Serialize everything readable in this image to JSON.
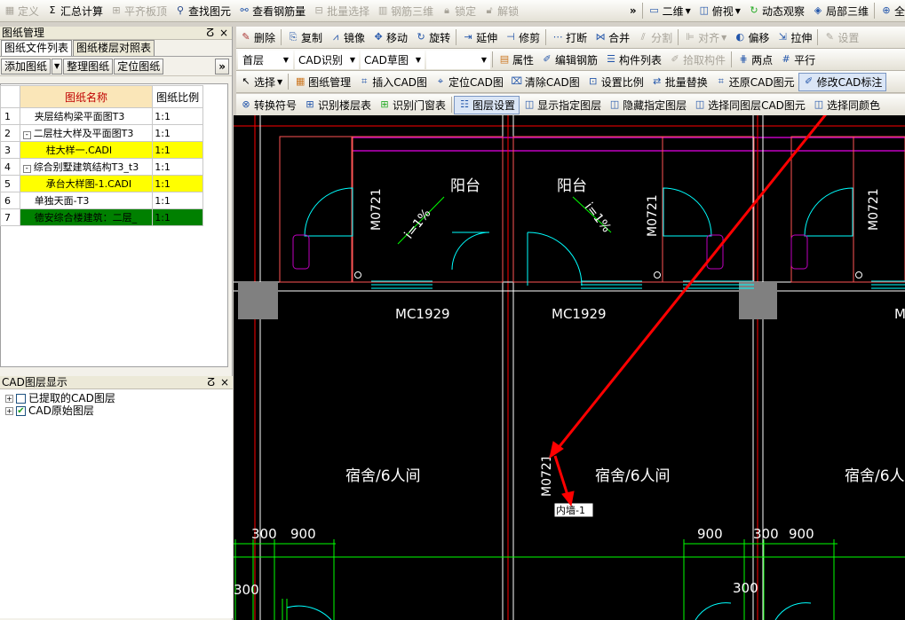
{
  "toolbar1": {
    "items": [
      "定义",
      "汇总计算",
      "平齐板顶",
      "查找图元",
      "查看钢筋量",
      "批量选择",
      "钢筋三维",
      "锁定",
      "解锁"
    ],
    "view_mode": "二维",
    "view_angle": "俯视",
    "dynamic": "动态观察",
    "local3d": "局部三维",
    "more": "»"
  },
  "toolbar2": {
    "items": [
      "删除",
      "复制",
      "镜像",
      "移动",
      "旋转",
      "延伸",
      "修剪",
      "打断",
      "合并",
      "分割",
      "对齐",
      "偏移",
      "拉伸",
      "设置"
    ]
  },
  "toolbar3": {
    "floor": "首层",
    "cad_recog": "CAD识别",
    "cad_draft": "CAD草图",
    "blank": "",
    "items": [
      "属性",
      "编辑钢筋",
      "构件列表",
      "拾取构件",
      "两点",
      "平行"
    ]
  },
  "toolbar4": {
    "select": "选择",
    "items": [
      "图纸管理",
      "插入CAD图",
      "定位CAD图",
      "清除CAD图",
      "设置比例",
      "批量替换",
      "还原CAD图元",
      "修改CAD标注"
    ]
  },
  "toolbar5": {
    "items": [
      "转换符号",
      "识别楼层表",
      "识别门窗表",
      "图层设置",
      "显示指定图层",
      "隐藏指定图层",
      "选择同图层CAD图元",
      "选择同颜色"
    ]
  },
  "drawing_panel": {
    "title": "图纸管理",
    "pin": "ꟷ",
    "close": "×",
    "tabs": [
      "图纸文件列表",
      "图纸楼层对照表"
    ],
    "buttons": [
      "添加图纸",
      "整理图纸",
      "定位图纸"
    ],
    "more": "»",
    "columns": [
      "图纸名称",
      "图纸比例"
    ],
    "rows": [
      {
        "n": "1",
        "name": "夹层结构梁平面图T3",
        "scale": "1:1",
        "style": "",
        "indent": 0,
        "exp": ""
      },
      {
        "n": "2",
        "name": "二层柱大样及平面图T3",
        "scale": "1:1",
        "style": "",
        "indent": 0,
        "exp": "-"
      },
      {
        "n": "3",
        "name": "柱大样一.CADI",
        "scale": "1:1",
        "style": "yellow",
        "indent": 1,
        "exp": ""
      },
      {
        "n": "4",
        "name": "综合别墅建筑结构T3_t3",
        "scale": "1:1",
        "style": "",
        "indent": 0,
        "exp": "-"
      },
      {
        "n": "5",
        "name": "承台大样图-1.CADI",
        "scale": "1:1",
        "style": "yellow",
        "indent": 1,
        "exp": ""
      },
      {
        "n": "6",
        "name": "单独天面-T3",
        "scale": "1:1",
        "style": "",
        "indent": 0,
        "exp": ""
      },
      {
        "n": "7",
        "name": "德安综合楼建筑：二层_",
        "scale": "1:1",
        "style": "green",
        "indent": 0,
        "exp": ""
      }
    ]
  },
  "layer_panel": {
    "title": "CAD图层显示",
    "pin": "ꟷ",
    "close": "×",
    "items": [
      {
        "label": "已提取的CAD图层",
        "checked": false
      },
      {
        "label": "CAD原始图层",
        "checked": true
      }
    ]
  },
  "cad": {
    "balcony": "阳台",
    "slope": "i=1%",
    "door_m0721": "M0721",
    "door_mc1929": "MC1929",
    "room": "宿舍/6人间",
    "dim_300": "300",
    "dim_900": "900",
    "edit_text": "内墙-1",
    "edge_m": "M",
    "colors": {
      "wall": "#ffffff",
      "red": "#ff0000",
      "magenta": "#c000c0",
      "cyan": "#00ffff",
      "green": "#00ff00",
      "gray": "#808080"
    }
  }
}
